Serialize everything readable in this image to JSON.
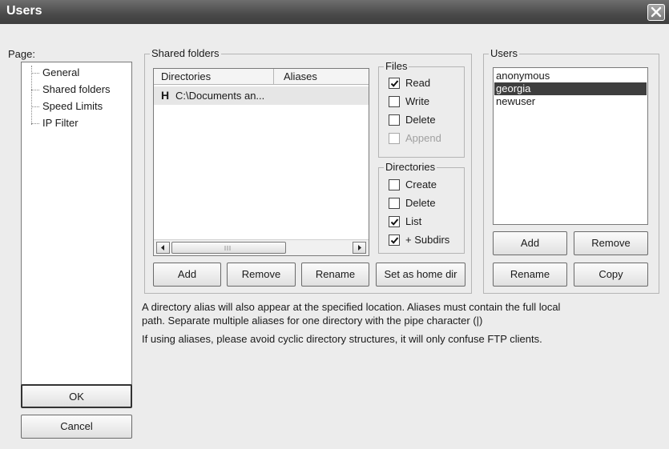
{
  "window": {
    "title": "Users"
  },
  "page_label": "Page:",
  "pages": [
    {
      "label": "General",
      "selected": false
    },
    {
      "label": "Shared folders",
      "selected": true
    },
    {
      "label": "Speed Limits",
      "selected": false
    },
    {
      "label": "IP Filter",
      "selected": false
    }
  ],
  "shared_folders": {
    "group_label": "Shared folders",
    "columns": [
      "Directories",
      "Aliases"
    ],
    "rows": [
      {
        "flag": "H",
        "directory": "C:\\Documents an...",
        "alias": ""
      }
    ],
    "buttons": {
      "add": "Add",
      "remove": "Remove",
      "rename": "Rename",
      "home": "Set as home dir"
    }
  },
  "files": {
    "group_label": "Files",
    "items": [
      {
        "label": "Read",
        "checked": true,
        "enabled": true
      },
      {
        "label": "Write",
        "checked": false,
        "enabled": true
      },
      {
        "label": "Delete",
        "checked": false,
        "enabled": true
      },
      {
        "label": "Append",
        "checked": false,
        "enabled": false
      }
    ]
  },
  "directories": {
    "group_label": "Directories",
    "items": [
      {
        "label": "Create",
        "checked": false
      },
      {
        "label": "Delete",
        "checked": false
      },
      {
        "label": "List",
        "checked": true
      },
      {
        "label": "+ Subdirs",
        "checked": true
      }
    ]
  },
  "users": {
    "group_label": "Users",
    "list": [
      {
        "name": "anonymous",
        "selected": false
      },
      {
        "name": "georgia",
        "selected": true
      },
      {
        "name": "newuser",
        "selected": false
      }
    ],
    "buttons": {
      "add": "Add",
      "remove": "Remove",
      "rename": "Rename",
      "copy": "Copy"
    }
  },
  "info": {
    "line1": "A directory alias will also appear at the specified location. Aliases must contain the full local",
    "line2": "path. Separate multiple aliases for one directory with the pipe character (|)",
    "line3": "If using aliases, please avoid cyclic directory structures, it will only confuse FTP clients."
  },
  "dialog_buttons": {
    "ok": "OK",
    "cancel": "Cancel"
  },
  "colors": {
    "selection": "#3e3e3e",
    "titlebar": "#4a4a4a",
    "face": "#ececec"
  }
}
